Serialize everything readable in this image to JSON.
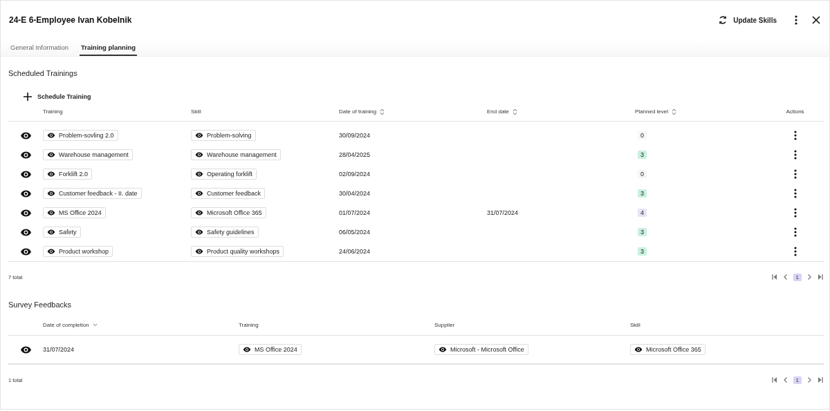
{
  "window": {
    "title": "24-E 6-Employee Ivan Kobelnik"
  },
  "header_actions": {
    "update_button": "Update Skills"
  },
  "tabs": [
    {
      "label": "General Information",
      "selected": false
    },
    {
      "label": "Training planning",
      "selected": true
    }
  ],
  "scheduled_trainings": {
    "title": "Scheduled Trainings",
    "add_button": "Schedule Training",
    "columns": [
      {
        "label": "Training",
        "kind": "plain"
      },
      {
        "label": "Skill",
        "kind": "plain"
      },
      {
        "label": "Date of training",
        "kind": "sortable"
      },
      {
        "label": "End date",
        "kind": "sortable"
      },
      {
        "label": "Planned level",
        "kind": "sortable"
      },
      {
        "label": "Actions",
        "kind": "plain"
      }
    ],
    "rows": [
      {
        "training": "Problem-sovling 2.0",
        "skill": "Problem-solving",
        "date": "30/09/2024",
        "level": "0",
        "color": "#f6f6f6"
      },
      {
        "training": "Warehouse management",
        "skill": "Warehouse management",
        "date": "28/04/2025",
        "level": "3",
        "color": "#c9f1df"
      },
      {
        "training": "Forklift 2.0",
        "skill": "Operating forklift",
        "date": "02/09/2024",
        "level": "0",
        "color": "#f6f6f6"
      },
      {
        "training": "Customer feedback - II. date",
        "skill": "Customer feedback",
        "date": "30/04/2024",
        "level": "3",
        "color": "#c9f1df"
      },
      {
        "training": "MS Office 2024",
        "skill": "Microsoft Office 365",
        "date": "01/07/2024",
        "end_date": "31/07/2024",
        "level": "4",
        "color": "#e6e3f7"
      },
      {
        "training": "Safety",
        "skill": "Safety guidelines",
        "date": "06/05/2024",
        "level": "3",
        "color": "#c9f1df"
      },
      {
        "training": "Product workshop",
        "skill": "Product quality workshops",
        "date": "24/06/2024",
        "level": "3",
        "color": "#c9f1df"
      }
    ],
    "total": "7 total",
    "pages": [
      {
        "label": "1",
        "selected": true
      }
    ]
  },
  "survey_feedbacks": {
    "title": "Survey Feedbacks",
    "columns": [
      {
        "label": "Date of completion",
        "kind": "sorted"
      },
      {
        "label": "Training",
        "kind": "plain"
      },
      {
        "label": "Supplier",
        "kind": "plain"
      },
      {
        "label": "Skill",
        "kind": "plain"
      }
    ],
    "rows": [
      {
        "date": "31/07/2024",
        "training": "MS Office 2024",
        "supplier": "Microsoft - Microsoft Office",
        "skill": "Microsoft Office 365"
      }
    ],
    "total": "1 total",
    "pages": [
      {
        "label": "1",
        "selected": true
      }
    ]
  }
}
